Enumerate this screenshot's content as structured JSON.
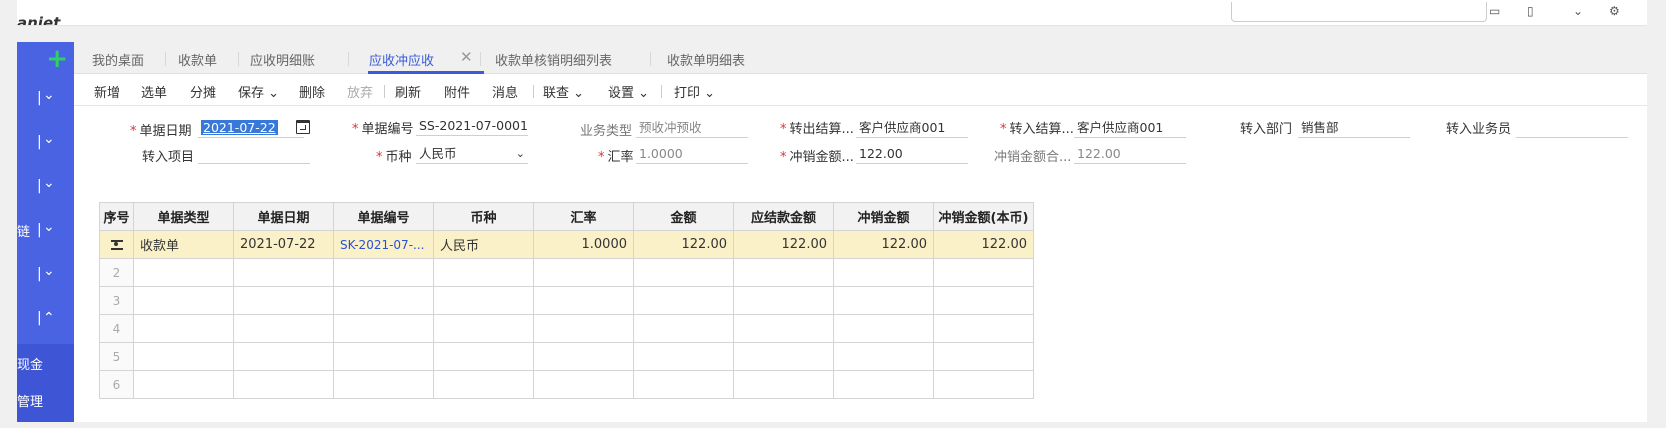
{
  "topbar": {
    "logo": "anjet",
    "crumb": "",
    "icons": [
      "bag-icon",
      "grid-icon",
      "chevron-icon",
      "settings-icon"
    ]
  },
  "sidebar": {
    "add_label": "+",
    "rows": [
      {
        "label": "",
        "expanded": false
      },
      {
        "label": "",
        "expanded": false
      },
      {
        "label": "",
        "expanded": false
      },
      {
        "label": "链",
        "expanded": false
      },
      {
        "label": "",
        "expanded": false
      },
      {
        "label": "",
        "expanded": true
      }
    ],
    "subitems": [
      "现金",
      "管理"
    ]
  },
  "tabs": [
    {
      "label": "我的桌面",
      "active": false
    },
    {
      "label": "收款单",
      "active": false
    },
    {
      "label": "应收明细账",
      "active": false
    },
    {
      "label": "应收冲应收",
      "active": true
    },
    {
      "label": "收款单核销明细列表",
      "active": false
    },
    {
      "label": "收款单明细表",
      "active": false
    }
  ],
  "tab_close": "✕",
  "toolbar": {
    "new": "新增",
    "select": "选单",
    "allocate": "分摊",
    "save": "保存",
    "delete": "删除",
    "discard": "放弃",
    "refresh": "刷新",
    "attach": "附件",
    "message": "消息",
    "linkcheck": "联查",
    "settings": "设置",
    "print": "打印"
  },
  "form": {
    "doc_date_label": "单据日期",
    "doc_date": "2021-07-22",
    "doc_no_label": "单据编号",
    "doc_no": "SS-2021-07-0001",
    "biz_type_label": "业务类型",
    "biz_type": "预收冲预收",
    "out_party_label": "转出结算...",
    "out_party": "客户供应商001",
    "in_party_label": "转入结算...",
    "in_party": "客户供应商001",
    "in_dept_label": "转入部门",
    "in_dept": "销售部",
    "in_staff_label": "转入业务员",
    "in_staff": "",
    "in_project_label": "转入项目",
    "in_project": "",
    "currency_label": "币种",
    "currency": "人民币",
    "rate_label": "汇率",
    "rate": "1.0000",
    "offset_amt_label": "冲销金额...",
    "offset_amt": "122.00",
    "offset_total_label": "冲销金额合...",
    "offset_total": "122.00"
  },
  "grid": {
    "headers": [
      "序号",
      "单据类型",
      "单据日期",
      "单据编号",
      "币种",
      "汇率",
      "金额",
      "应结款金额",
      "冲销金额",
      "冲销金额(本币)"
    ],
    "rows": [
      {
        "idx": "",
        "type": "收款单",
        "date": "2021-07-22",
        "no": "SK-2021-07-...",
        "currency": "人民币",
        "rate": "1.0000",
        "amount": "122.00",
        "due": "122.00",
        "offset": "122.00",
        "offset_local": "122.00"
      },
      {
        "idx": "2",
        "type": "",
        "date": "",
        "no": "",
        "currency": "",
        "rate": "",
        "amount": "",
        "due": "",
        "offset": "",
        "offset_local": ""
      },
      {
        "idx": "3",
        "type": "",
        "date": "",
        "no": "",
        "currency": "",
        "rate": "",
        "amount": "",
        "due": "",
        "offset": "",
        "offset_local": ""
      },
      {
        "idx": "4",
        "type": "",
        "date": "",
        "no": "",
        "currency": "",
        "rate": "",
        "amount": "",
        "due": "",
        "offset": "",
        "offset_local": ""
      },
      {
        "idx": "5",
        "type": "",
        "date": "",
        "no": "",
        "currency": "",
        "rate": "",
        "amount": "",
        "due": "",
        "offset": "",
        "offset_local": ""
      },
      {
        "idx": "6",
        "type": "",
        "date": "",
        "no": "",
        "currency": "",
        "rate": "",
        "amount": "",
        "due": "",
        "offset": "",
        "offset_local": ""
      }
    ]
  },
  "colors": {
    "accent": "#3b5bdb",
    "sidebar": "#4a63e3",
    "selected_row": "#fbf1c8",
    "required": "#e03131",
    "add_green": "#2fd166"
  }
}
